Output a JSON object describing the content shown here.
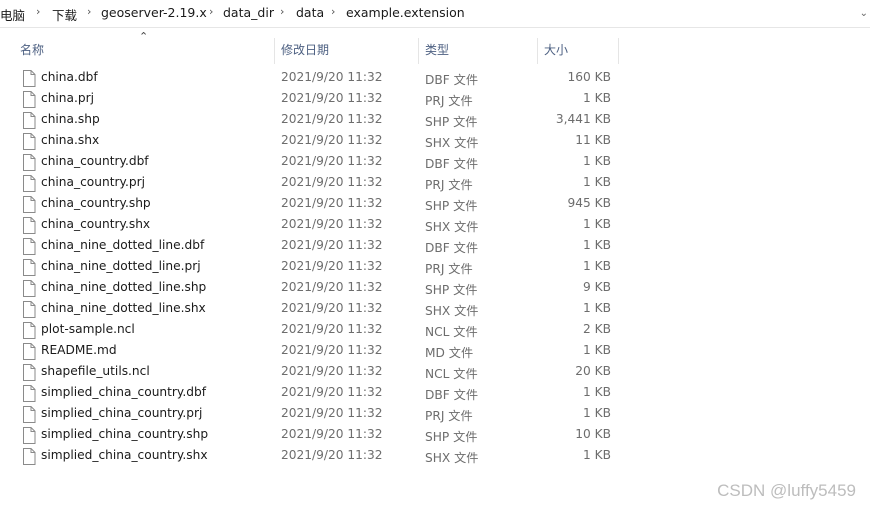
{
  "breadcrumb": {
    "items": [
      "电脑",
      "下载",
      "geoserver-2.19.x",
      "data_dir",
      "data",
      "example.extension"
    ],
    "separator": "›"
  },
  "columns": {
    "name": "名称",
    "date": "修改日期",
    "type": "类型",
    "size": "大小"
  },
  "files": [
    {
      "name": "china.dbf",
      "date": "2021/9/20 11:32",
      "type": "DBF 文件",
      "size": "160 KB"
    },
    {
      "name": "china.prj",
      "date": "2021/9/20 11:32",
      "type": "PRJ 文件",
      "size": "1 KB"
    },
    {
      "name": "china.shp",
      "date": "2021/9/20 11:32",
      "type": "SHP 文件",
      "size": "3,441 KB"
    },
    {
      "name": "china.shx",
      "date": "2021/9/20 11:32",
      "type": "SHX 文件",
      "size": "11 KB"
    },
    {
      "name": "china_country.dbf",
      "date": "2021/9/20 11:32",
      "type": "DBF 文件",
      "size": "1 KB"
    },
    {
      "name": "china_country.prj",
      "date": "2021/9/20 11:32",
      "type": "PRJ 文件",
      "size": "1 KB"
    },
    {
      "name": "china_country.shp",
      "date": "2021/9/20 11:32",
      "type": "SHP 文件",
      "size": "945 KB"
    },
    {
      "name": "china_country.shx",
      "date": "2021/9/20 11:32",
      "type": "SHX 文件",
      "size": "1 KB"
    },
    {
      "name": "china_nine_dotted_line.dbf",
      "date": "2021/9/20 11:32",
      "type": "DBF 文件",
      "size": "1 KB"
    },
    {
      "name": "china_nine_dotted_line.prj",
      "date": "2021/9/20 11:32",
      "type": "PRJ 文件",
      "size": "1 KB"
    },
    {
      "name": "china_nine_dotted_line.shp",
      "date": "2021/9/20 11:32",
      "type": "SHP 文件",
      "size": "9 KB"
    },
    {
      "name": "china_nine_dotted_line.shx",
      "date": "2021/9/20 11:32",
      "type": "SHX 文件",
      "size": "1 KB"
    },
    {
      "name": "plot-sample.ncl",
      "date": "2021/9/20 11:32",
      "type": "NCL 文件",
      "size": "2 KB"
    },
    {
      "name": "README.md",
      "date": "2021/9/20 11:32",
      "type": "MD 文件",
      "size": "1 KB"
    },
    {
      "name": "shapefile_utils.ncl",
      "date": "2021/9/20 11:32",
      "type": "NCL 文件",
      "size": "20 KB"
    },
    {
      "name": "simplied_china_country.dbf",
      "date": "2021/9/20 11:32",
      "type": "DBF 文件",
      "size": "1 KB"
    },
    {
      "name": "simplied_china_country.prj",
      "date": "2021/9/20 11:32",
      "type": "PRJ 文件",
      "size": "1 KB"
    },
    {
      "name": "simplied_china_country.shp",
      "date": "2021/9/20 11:32",
      "type": "SHP 文件",
      "size": "10 KB"
    },
    {
      "name": "simplied_china_country.shx",
      "date": "2021/9/20 11:32",
      "type": "SHX 文件",
      "size": "1 KB"
    }
  ],
  "icons": {
    "file": "file-icon",
    "sort": "sort-up-icon",
    "breadcrumb_sep": "chevron-right-icon",
    "dropdown": "chevron-down-icon"
  },
  "watermark": "CSDN @luffy5459"
}
